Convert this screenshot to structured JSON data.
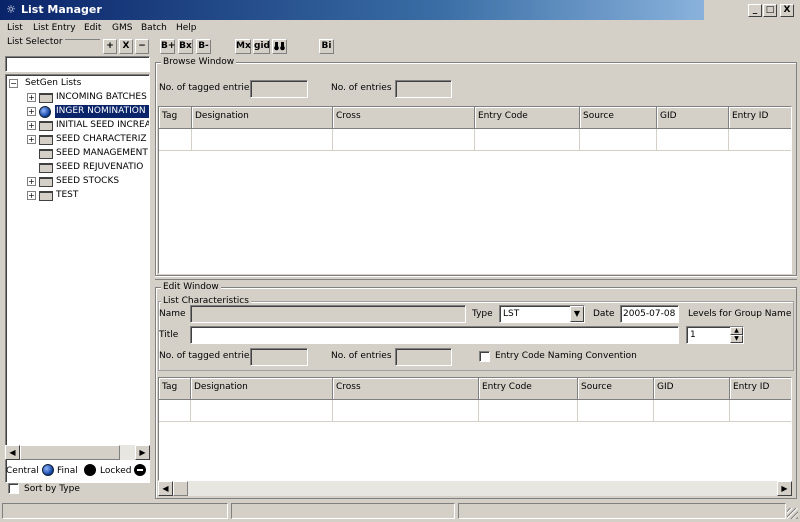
{
  "window": {
    "title": "List Manager",
    "icon": "app-icon",
    "minimize": "_",
    "maximize": "□",
    "close": "X"
  },
  "menu": [
    "List",
    "List Entry",
    "Edit",
    "GMS",
    "Batch",
    "Help"
  ],
  "left_panel": {
    "label": "List Selector",
    "buttons": {
      "add": "+",
      "expand": "X",
      "remove": "−"
    },
    "tree_root": "SetGen Lists",
    "tree_items": [
      {
        "label": "INCOMING BATCHES",
        "icon": "folder-icon",
        "expandable": true
      },
      {
        "label": "INGER NOMINATION ...",
        "icon": "globe-icon",
        "expandable": true,
        "selected": true
      },
      {
        "label": "INITIAL SEED INCREA",
        "icon": "folder-icon",
        "expandable": true
      },
      {
        "label": "SEED CHARACTERIZ",
        "icon": "folder-icon",
        "expandable": true
      },
      {
        "label": "SEED MANAGEMENT",
        "icon": "folder-icon",
        "expandable": false
      },
      {
        "label": "SEED REJUVENATIO",
        "icon": "folder-icon",
        "expandable": false
      },
      {
        "label": "SEED STOCKS",
        "icon": "folder-icon",
        "expandable": true
      },
      {
        "label": "TEST",
        "icon": "folder-icon",
        "expandable": true
      }
    ],
    "legend": {
      "central": "Central",
      "final": "Final",
      "locked": "Locked"
    },
    "sort_by_type": "Sort by Type"
  },
  "toolbar": {
    "b_plus": "B+",
    "b_x": "Bx",
    "b_minus": "B-",
    "mx": "Mx",
    "gid": "gid",
    "binoculars": "binoculars-icon",
    "bi": "Bi"
  },
  "browse": {
    "title": "Browse Window",
    "tagged_label": "No. of tagged entries",
    "tagged_value": "",
    "entries_label": "No. of entries",
    "entries_value": "",
    "columns": [
      "Tag",
      "Designation",
      "Cross",
      "Entry Code",
      "Source",
      "GID",
      "Entry ID"
    ]
  },
  "edit": {
    "title": "Edit Window",
    "characteristics_label": "List Characteristics",
    "name_label": "Name",
    "name_value": "",
    "type_label": "Type",
    "type_value": "LST",
    "date_label": "Date",
    "date_value": "2005-07-08",
    "levels_label": "Levels for Group Name",
    "levels_value": "1",
    "title_label": "Title",
    "title_value": "",
    "tagged_label": "No. of tagged entries",
    "entries_label": "No. of entries",
    "naming_convention": "Entry Code Naming Convention",
    "columns": [
      "Tag",
      "Designation",
      "Cross",
      "Entry Code",
      "Source",
      "GID",
      "Entry ID"
    ]
  },
  "colors": {
    "title_bar": "#0a246a",
    "selection": "#0a246a",
    "window_bg": "#d4d0c8"
  }
}
